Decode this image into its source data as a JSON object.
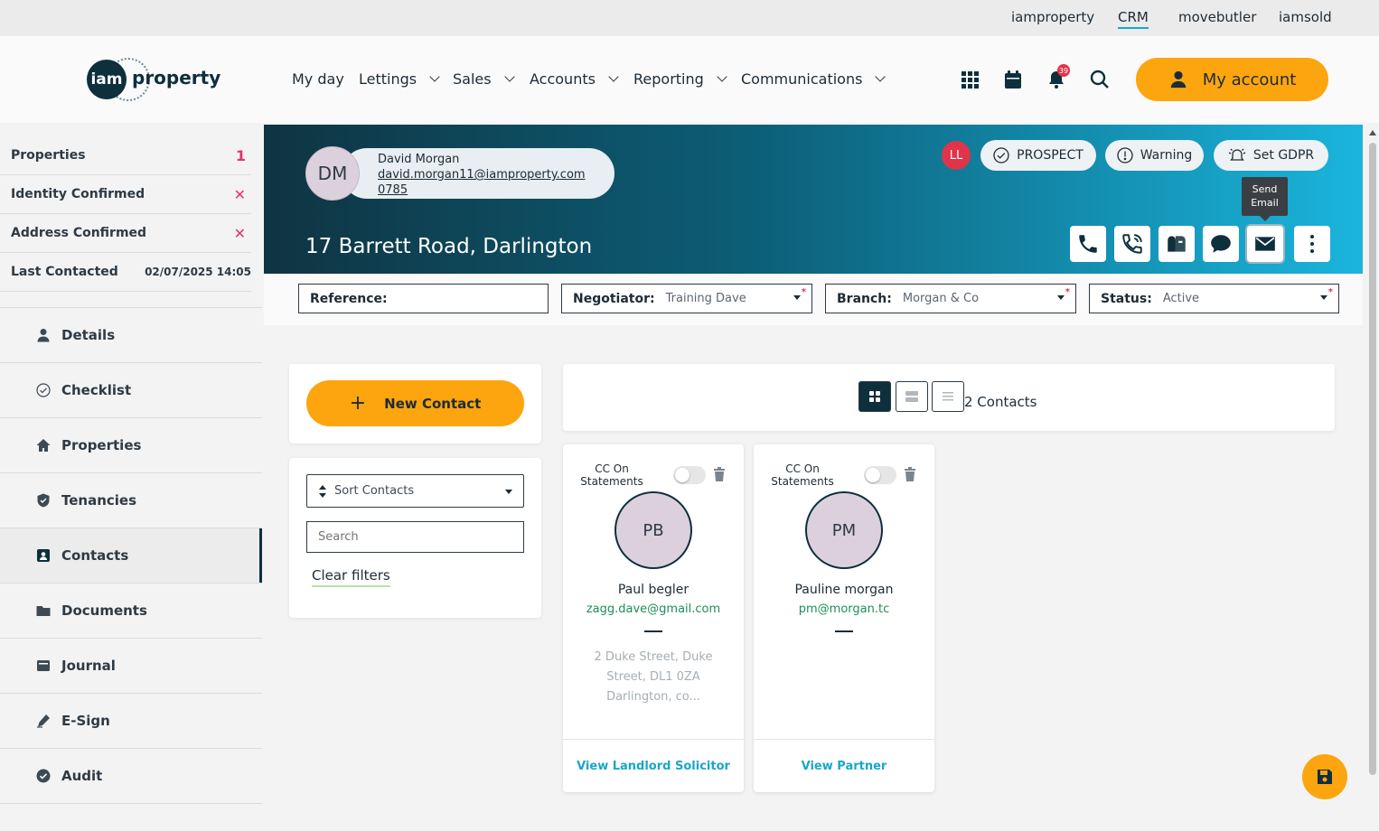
{
  "top_links": [
    "iamproperty",
    "CRM",
    "movebutler",
    "iamsold"
  ],
  "logo": {
    "badge_text": "iam",
    "word": "property"
  },
  "nav": {
    "my_day": "My day",
    "lettings": "Lettings",
    "sales": "Sales",
    "accounts": "Accounts",
    "reporting": "Reporting",
    "communications": "Communications"
  },
  "header_icons": {
    "apps": "grid-icon",
    "calendar": "calendar-icon",
    "notifications": "bell-icon",
    "search": "search-icon"
  },
  "notification_count": "39",
  "my_account_label": "My account",
  "summary": [
    {
      "label": "Properties",
      "value": "1"
    },
    {
      "label": "Identity Confirmed",
      "value": "✕"
    },
    {
      "label": "Address Confirmed",
      "value": "✕"
    },
    {
      "label": "Last Contacted",
      "value": "02/07/2025 14:05"
    }
  ],
  "side_nav": [
    "Details",
    "Checklist",
    "Properties",
    "Tenancies",
    "Contacts",
    "Documents",
    "Journal",
    "E-Sign",
    "Audit"
  ],
  "side_nav_active": "Contacts",
  "person": {
    "initials": "DM",
    "name": "David Morgan",
    "email": "david.morgan11@iamproperty.com",
    "phone": "0785"
  },
  "address": "17 Barrett Road, Darlington",
  "hero": {
    "tag_initials": "LL",
    "prospect_label": "PROSPECT",
    "warning_label": "Warning",
    "gdpr_label": "Set GDPR",
    "tooltip_line1": "Send",
    "tooltip_line2": "Email"
  },
  "fields": {
    "reference_label": "Reference:",
    "reference_value": "",
    "negotiator_label": "Negotiator:",
    "negotiator_value": "Training Dave",
    "branch_label": "Branch:",
    "branch_value": "Morgan & Co",
    "status_label": "Status:",
    "status_value": "Active",
    "required_mark": "*"
  },
  "new_contact_label": "New Contact",
  "sort_contacts_label": "Sort Contacts",
  "search_placeholder": "Search",
  "clear_filters_label": "Clear filters",
  "contacts_count": "2 Contacts",
  "contacts": [
    {
      "cc_label": "CC On Statements",
      "initials": "PB",
      "name": "Paul begler",
      "email": "zagg.dave@gmail.com",
      "address": "2 Duke Street, Duke Street, DL1 0ZA Darlington, co...",
      "link": "View Landlord Solicitor"
    },
    {
      "cc_label": "CC On Statements",
      "initials": "PM",
      "name": "Pauline morgan",
      "email": "pm@morgan.tc",
      "address": "",
      "link": "View Partner"
    }
  ],
  "colors": {
    "accent": "#fca50e",
    "brand_dark": "#0e2f3c",
    "link": "#1aa6c8",
    "email_green": "#1f8f56",
    "alert": "#e0344a"
  }
}
